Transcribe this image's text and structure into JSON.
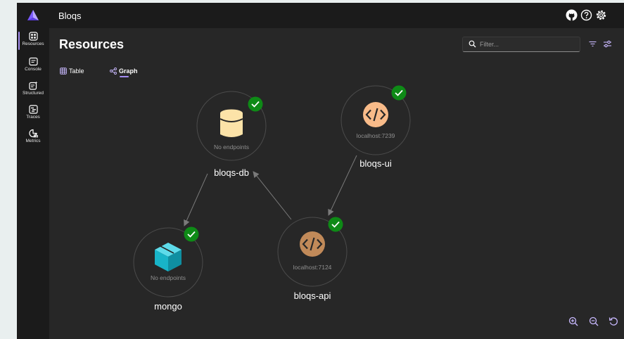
{
  "app": {
    "title": "Bloqs",
    "colors": {
      "accent": "#a58ef2",
      "status_ok": "#0e8a16",
      "background": "#272727",
      "chrome": "#1b1b1b"
    },
    "top_icons": [
      "github-icon",
      "help-icon",
      "settings-icon"
    ]
  },
  "sidebar": {
    "items": [
      {
        "label": "Resources",
        "icon": "resources-icon",
        "active": true
      },
      {
        "label": "Console",
        "icon": "console-icon",
        "active": false
      },
      {
        "label": "Structured",
        "icon": "structured-icon",
        "active": false
      },
      {
        "label": "Traces",
        "icon": "traces-icon",
        "active": false
      },
      {
        "label": "Metrics",
        "icon": "metrics-icon",
        "active": false
      }
    ]
  },
  "page": {
    "title": "Resources",
    "filter_placeholder": "Filter...",
    "tabs": [
      {
        "label": "Table",
        "icon": "table-icon",
        "selected": false
      },
      {
        "label": "Graph",
        "icon": "graph-icon",
        "selected": true
      }
    ]
  },
  "graph": {
    "nodes": [
      {
        "name": "bloqs-db",
        "subtitle": "No endpoints",
        "icon": "database-icon",
        "icon_color": "#fce3a8",
        "status": "running"
      },
      {
        "name": "bloqs-ui",
        "subtitle": "localhost:7239",
        "icon": "code-icon",
        "icon_color": "#f8bb89",
        "status": "running"
      },
      {
        "name": "mongo",
        "subtitle": "No endpoints",
        "icon": "cube-icon",
        "icon_color": "#18b4c8",
        "status": "running"
      },
      {
        "name": "bloqs-api",
        "subtitle": "localhost:7124",
        "icon": "code-icon",
        "icon_color": "#c18a59",
        "status": "running"
      }
    ],
    "edges": [
      {
        "from": "bloqs-db",
        "to": "mongo"
      },
      {
        "from": "bloqs-api",
        "to": "bloqs-db"
      },
      {
        "from": "bloqs-ui",
        "to": "bloqs-api"
      }
    ]
  },
  "zoom_controls": [
    "zoom-in-icon",
    "zoom-out-icon",
    "reset-icon"
  ]
}
